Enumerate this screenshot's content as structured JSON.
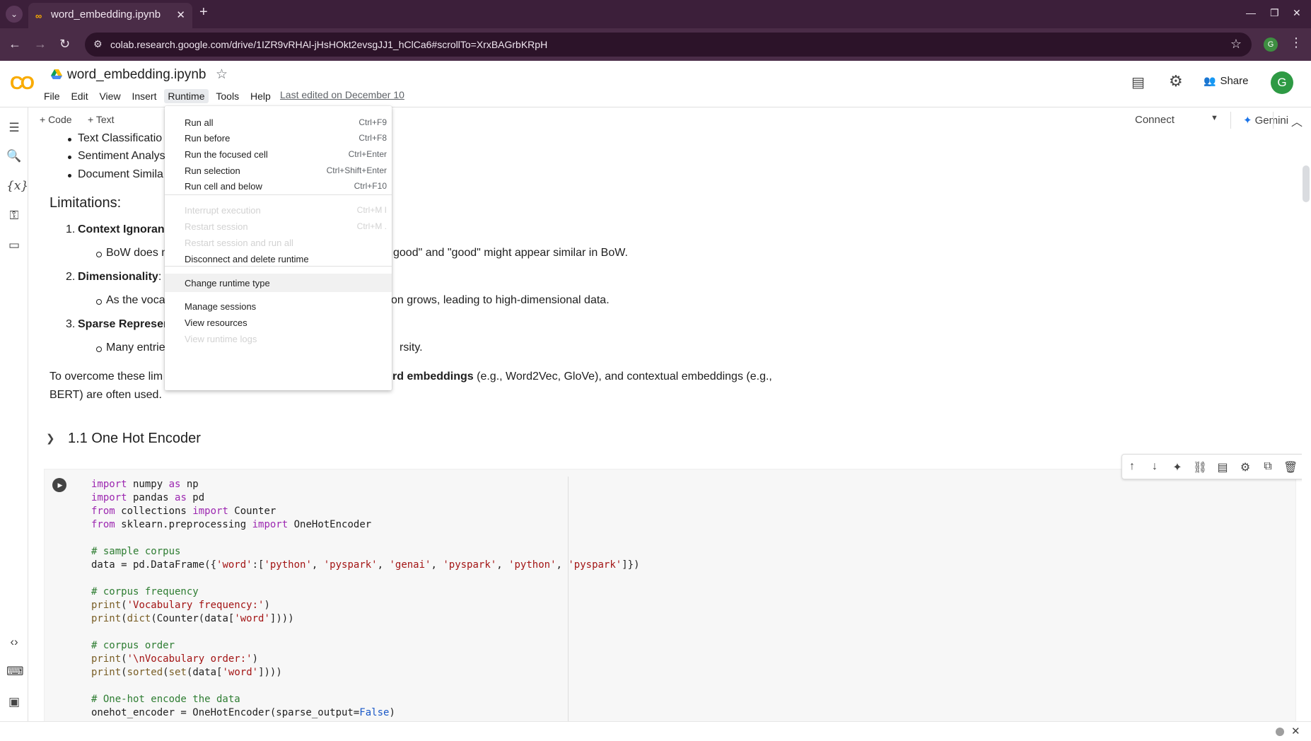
{
  "browser": {
    "tab_title": "word_embedding.ipynb",
    "tab_close": "✕",
    "new_tab": "+",
    "tabs_menu": "⌄",
    "url": "colab.research.google.com/drive/1IZR9vRHAl-jHsHOkt2evsgJJ1_hClCa6#scrollTo=XrxBAGrbKRpH",
    "profile_initial": "G",
    "window_controls": [
      "—",
      "❐",
      "✕"
    ]
  },
  "colab": {
    "logo": "CO",
    "notebook_title": "word_embedding.ipynb",
    "menu": [
      "File",
      "Edit",
      "View",
      "Insert",
      "Runtime",
      "Tools",
      "Help"
    ],
    "last_edited": "Last edited on December 10",
    "share_label": "Share",
    "avatar_initial": "G",
    "brand_color": "#f9ab00"
  },
  "toolbar": {
    "add_code": "+ Code",
    "add_text": "+ Text",
    "connect": "Connect",
    "gemini": "Gemini"
  },
  "content": {
    "bullets_top": [
      "Text Classificatio",
      "Sentiment Analys",
      "Document Simila"
    ],
    "limitations_heading": "Limitations:",
    "lim1_num": "1.",
    "lim1_title": "Context Ignoranc",
    "lim1_sub_a": "BoW does n",
    "lim1_sub_b": "good\" and \"good\" might appear similar in BoW.",
    "lim2_num": "2.",
    "lim2_title": "Dimensionality",
    "lim2_colon": ":",
    "lim2_sub_a": "As the voca",
    "lim2_sub_b": "on grows, leading to high-dimensional data.",
    "lim3_num": "3.",
    "lim3_title": "Sparse Represen",
    "lim3_sub_a": "Many entrie",
    "lim3_sub_b": "rsity.",
    "overcome_a": "To overcome these lim",
    "overcome_bold": "rd embeddings",
    "overcome_b": " (e.g., Word2Vec, GloVe), and contextual embeddings (e.g.,",
    "overcome_line2": "BERT) are often used.",
    "section_title": "1.1 One Hot Encoder"
  },
  "runtime_menu": {
    "items": [
      {
        "label": "Run all",
        "shortcut": "Ctrl+F9",
        "disabled": false
      },
      {
        "label": "Run before",
        "shortcut": "Ctrl+F8",
        "disabled": false
      },
      {
        "label": "Run the focused cell",
        "shortcut": "Ctrl+Enter",
        "disabled": false
      },
      {
        "label": "Run selection",
        "shortcut": "Ctrl+Shift+Enter",
        "disabled": false
      },
      {
        "label": "Run cell and below",
        "shortcut": "Ctrl+F10",
        "disabled": false
      },
      {
        "label": "Interrupt execution",
        "shortcut": "Ctrl+M I",
        "disabled": true
      },
      {
        "label": "Restart session",
        "shortcut": "Ctrl+M .",
        "disabled": true
      },
      {
        "label": "Restart session and run all",
        "shortcut": "",
        "disabled": true
      },
      {
        "label": "Disconnect and delete runtime",
        "shortcut": "",
        "disabled": false
      },
      {
        "label": "Change runtime type",
        "shortcut": "",
        "disabled": false
      },
      {
        "label": "Manage sessions",
        "shortcut": "",
        "disabled": false
      },
      {
        "label": "View resources",
        "shortcut": "",
        "disabled": false
      },
      {
        "label": "View runtime logs",
        "shortcut": "",
        "disabled": true
      }
    ]
  },
  "code_cell": {
    "lines": [
      "import numpy as np",
      "import pandas as pd",
      "from collections import Counter",
      "from sklearn.preprocessing import OneHotEncoder",
      "",
      "# sample corpus",
      "data = pd.DataFrame({'word':['python', 'pyspark', 'genai', 'pyspark', 'python', 'pyspark']})",
      "",
      "# corpus frequency",
      "print('Vocabulary frequency:')",
      "print(dict(Counter(data['word'])))",
      "",
      "# corpus order",
      "print('\\nVocabulary order:')",
      "print(sorted(set(data['word'])))",
      "",
      "# One-hot encode the data",
      "onehot_encoder = OneHotEncoder(sparse_output=False)"
    ]
  }
}
